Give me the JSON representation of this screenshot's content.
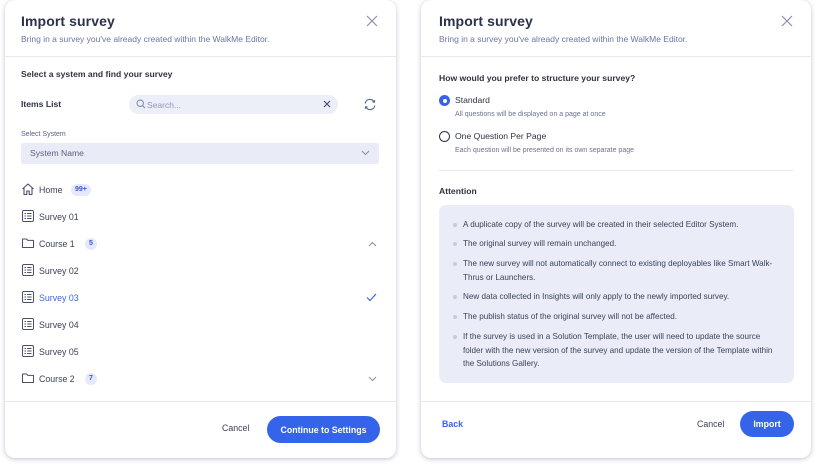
{
  "left_panel": {
    "title": "Import survey",
    "subtitle": "Bring in a survey you've already created within the WalkMe Editor.",
    "section_title": "Select a system and find your survey",
    "items_list_label": "Items List",
    "search": {
      "placeholder": "Search...",
      "value": ""
    },
    "select_system_label": "Select System",
    "select_system_value": "System Name",
    "tree": [
      {
        "label": "Home",
        "icon": "home-icon",
        "badge": "99+",
        "right": ""
      },
      {
        "label": "Survey 01",
        "icon": "survey-icon",
        "badge": "",
        "right": ""
      },
      {
        "label": "Course 1",
        "icon": "folder-icon",
        "badge": "5",
        "right": "chevron-up-icon"
      },
      {
        "label": "Survey 02",
        "icon": "survey-icon",
        "badge": "",
        "right": ""
      },
      {
        "label": "Survey 03",
        "icon": "survey-icon",
        "badge": "",
        "right": "check-icon",
        "selected": true
      },
      {
        "label": "Survey 04",
        "icon": "survey-icon",
        "badge": "",
        "right": ""
      },
      {
        "label": "Survey 05",
        "icon": "survey-icon",
        "badge": "",
        "right": ""
      },
      {
        "label": "Course 2",
        "icon": "folder-icon",
        "badge": "7",
        "right": "chevron-down-icon"
      }
    ],
    "cancel_label": "Cancel",
    "continue_label": "Continue to Settings"
  },
  "right_panel": {
    "title": "Import survey",
    "subtitle": "Bring in a survey you've already created within the WalkMe Editor.",
    "structure_question": "How would you prefer to structure your survey?",
    "options": [
      {
        "label": "Standard",
        "description": "All questions will be displayed on a page at once",
        "selected": true
      },
      {
        "label": "One Question Per Page",
        "description": "Each question will be presented on its own separate page",
        "selected": false
      }
    ],
    "attention_title": "Attention",
    "attention_items": [
      "A duplicate copy of the survey will be created in their selected Editor System.",
      "The original survey will remain unchanged.",
      "The new survey will not automatically connect to existing deployables like Smart Walk-Thrus or Launchers.",
      "New data collected in Insights will only apply to the newly imported survey.",
      "The publish status of the original survey will not be affected.",
      "If the survey is used in a Solution Template, the user will need to update the source folder with the new version of the survey and update the version of the Template within the Solutions Gallery."
    ],
    "back_label": "Back",
    "cancel_label": "Cancel",
    "import_label": "Import"
  },
  "colors": {
    "accent": "#3563e9",
    "selected_text": "#3c66e8",
    "badge_bg": "#e4e9fb",
    "attention_bg": "#eaedf7"
  }
}
